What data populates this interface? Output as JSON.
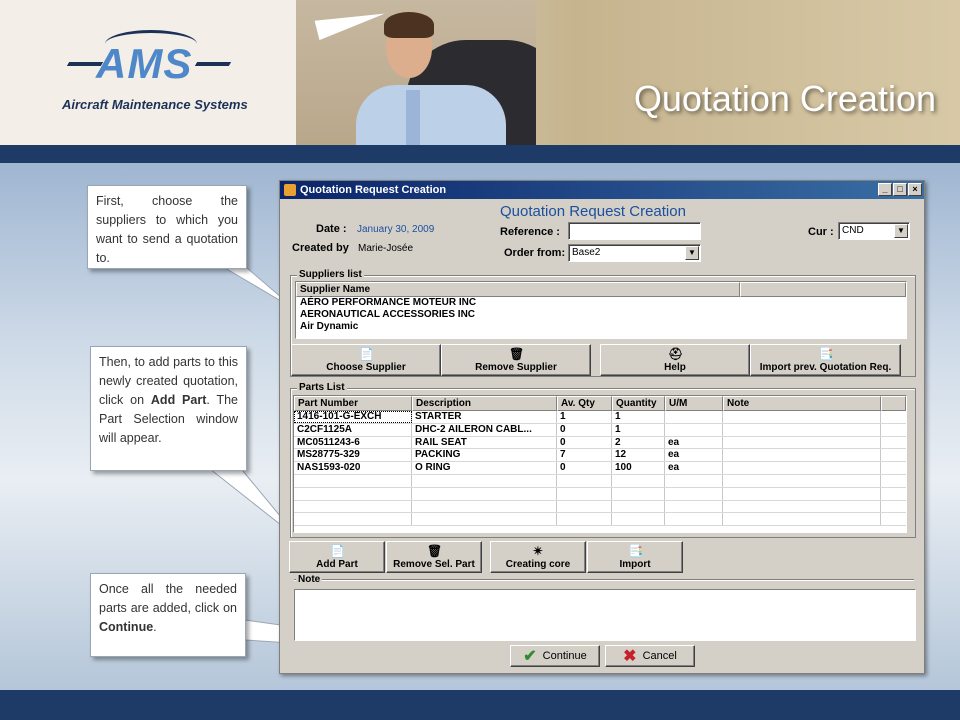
{
  "slide": {
    "title": "Quotation Creation",
    "logo": {
      "text": "AMS",
      "subtitle": "Aircraft Maintenance Systems"
    }
  },
  "callouts": {
    "first": "First, choose the suppliers to which you want to send a quotation to.",
    "second_pre": "Then, to add parts to this newly created quotation, click on ",
    "second_bold": "Add Part",
    "second_post": ". The Part Selection window will appear.",
    "third_pre": "Once all the needed parts are added, click on ",
    "third_bold": "Continue",
    "third_post": "."
  },
  "window": {
    "title": "Quotation Request Creation",
    "buttons": {
      "minimize": "_",
      "maximize": "□",
      "close": "×"
    },
    "form_title": "Quotation Request Creation",
    "date_label": "Date :",
    "date_value": "January 30, 2009",
    "created_by_label": "Created by",
    "created_by_value": "Marie-Josée",
    "reference_label": "Reference :",
    "reference_value": "",
    "order_from_label": "Order from:",
    "order_from_value": "Base2",
    "cur_label": "Cur :",
    "cur_value": "CND"
  },
  "suppliers": {
    "group_label": "Suppliers list",
    "header": "Supplier Name",
    "rows": [
      "AÉRO PERFORMANCE MOTEUR INC",
      "AERONAUTICAL ACCESSORIES INC",
      "Air Dynamic"
    ],
    "buttons": {
      "choose": "Choose Supplier",
      "remove": "Remove Supplier",
      "help": "Help",
      "import": "Import prev. Quotation Req."
    }
  },
  "parts": {
    "group_label": "Parts List",
    "headers": [
      "Part Number",
      "Description",
      "Av. Qty",
      "Quantity",
      "U/M",
      "Note"
    ],
    "rows": [
      [
        "1416-101-G-EXCH",
        "STARTER",
        "1",
        "1",
        "",
        ""
      ],
      [
        "C2CF1125A",
        "DHC-2 AILERON CABL...",
        "0",
        "1",
        "",
        ""
      ],
      [
        "MC0511243-6",
        "RAIL SEAT",
        "0",
        "2",
        "ea",
        ""
      ],
      [
        "MS28775-329",
        "PACKING",
        "7",
        "12",
        "ea",
        ""
      ],
      [
        "NAS1593-020",
        "O RING",
        "0",
        "100",
        "ea",
        ""
      ]
    ],
    "buttons": {
      "add": "Add Part",
      "remove": "Remove Sel. Part",
      "core": "Creating core",
      "import": "Import"
    }
  },
  "note": {
    "label": "Note"
  },
  "dialog": {
    "continue": "Continue",
    "cancel": "Cancel"
  },
  "icons": {
    "choose": "doc-plus-icon",
    "remove": "trash-icon",
    "help": "help-person-icon",
    "import": "import-doc-icon",
    "core": "core-star-icon",
    "continue": "checkmark-icon",
    "cancel": "x-icon"
  }
}
